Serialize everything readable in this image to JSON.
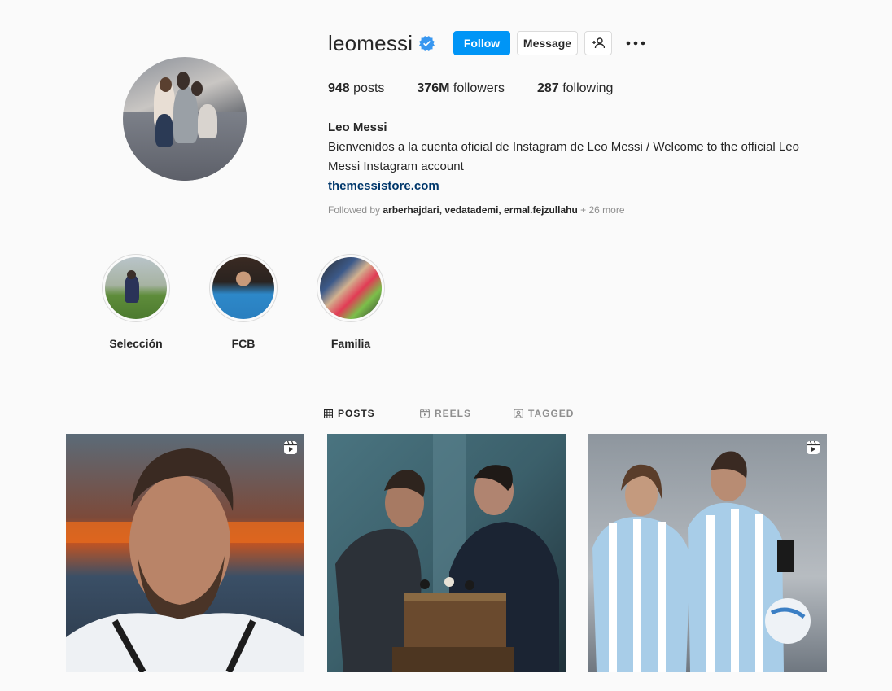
{
  "profile": {
    "username": "leomessi",
    "verified": true,
    "follow_label": "Follow",
    "message_label": "Message",
    "stats": {
      "posts_count": "948",
      "posts_label": "posts",
      "followers_count": "376M",
      "followers_label": "followers",
      "following_count": "287",
      "following_label": "following"
    },
    "full_name": "Leo Messi",
    "bio": "Bienvenidos a la cuenta oficial de Instagram de Leo Messi / Welcome to the official Leo Messi Instagram account",
    "website": "themessistore.com",
    "followed_by": {
      "prefix": "Followed by",
      "names": "arberhajdari, vedatademi, ermal.fejzullahu",
      "more": "+ 26 more"
    }
  },
  "highlights": [
    {
      "label": "Selección"
    },
    {
      "label": "FCB"
    },
    {
      "label": "Familia"
    }
  ],
  "tabs": [
    {
      "label": "POSTS",
      "icon": "grid-icon",
      "active": true
    },
    {
      "label": "REELS",
      "icon": "reels-icon",
      "active": false
    },
    {
      "label": "TAGGED",
      "icon": "tagged-icon",
      "active": false
    }
  ],
  "posts": [
    {
      "type": "reel",
      "icon": "reel-icon"
    },
    {
      "type": "photo"
    },
    {
      "type": "reel",
      "icon": "reel-icon"
    }
  ],
  "colors": {
    "accent": "#0095f6",
    "verified": "#3897f0",
    "link": "#00376b",
    "background": "#fafafa"
  }
}
